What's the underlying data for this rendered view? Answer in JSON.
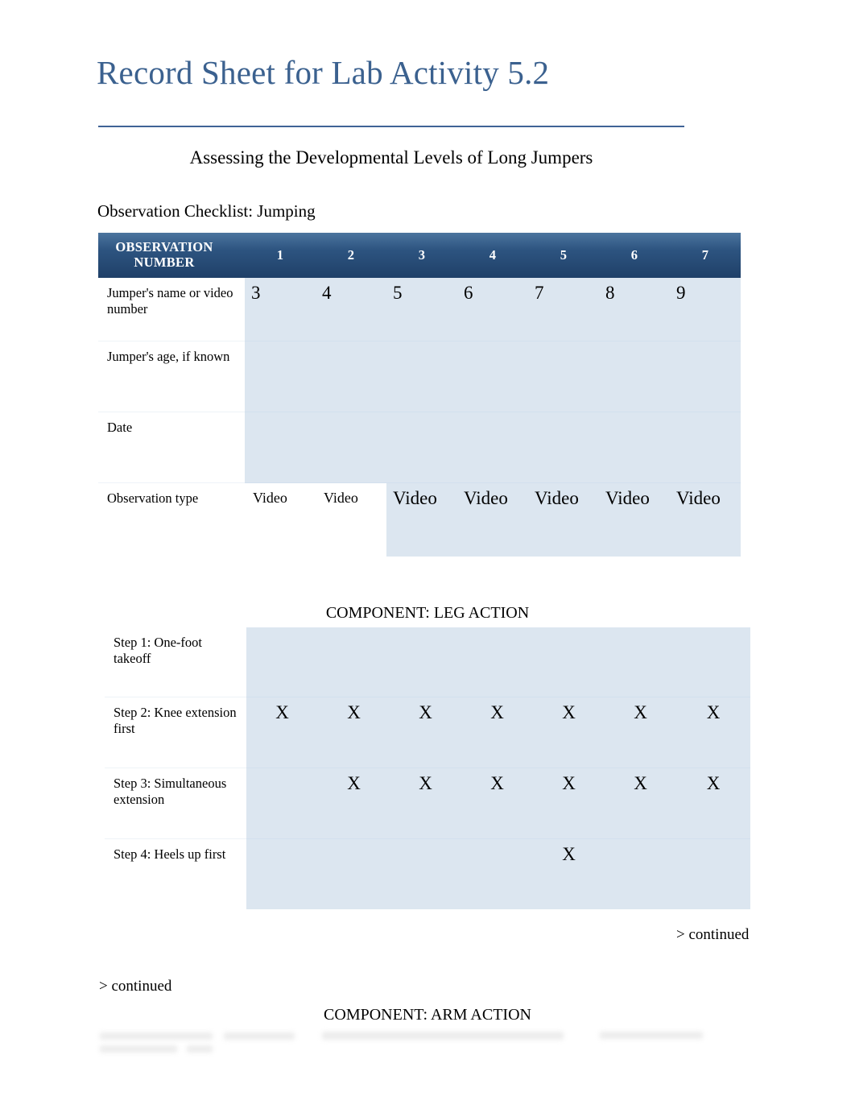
{
  "document": {
    "title": "Record Sheet for Lab Activity 5.2",
    "subtitle": "Assessing the Developmental Levels of Long Jumpers",
    "section_label": "Observation Checklist: Jumping",
    "rule_color": "#3f6396",
    "title_color": "#3b618f",
    "header_band_color": "#1f4068",
    "cell_fill_color": "#dce6f0"
  },
  "observation_table": {
    "header": {
      "row_label": "OBSERVATION NUMBER",
      "row_label_line1": "OBSERVATION",
      "row_label_line2": "NUMBER",
      "columns": [
        "1",
        "2",
        "3",
        "4",
        "5",
        "6",
        "7"
      ]
    },
    "rows": [
      {
        "label": "Jumper's name or video number",
        "values": [
          "3",
          "4",
          "5",
          "6",
          "7",
          "8",
          "9"
        ],
        "style": "large"
      },
      {
        "label": "Jumper's age, if known",
        "values": [
          "",
          "",
          "",
          "",
          "",
          "",
          ""
        ],
        "style": "large"
      },
      {
        "label": "Date",
        "values": [
          "",
          "",
          "",
          "",
          "",
          "",
          ""
        ],
        "style": "large"
      },
      {
        "label": "Observation type",
        "values": [
          "Video",
          "Video",
          "Video",
          "Video",
          "Video",
          "Video",
          "Video"
        ],
        "style": "mixed",
        "small_cells": [
          0,
          1
        ]
      }
    ]
  },
  "leg_action": {
    "title": "COMPONENT: LEG ACTION",
    "rows": [
      {
        "label": "Step 1: One-foot takeoff",
        "marks": [
          "",
          "",
          "",
          "",
          "",
          "",
          ""
        ]
      },
      {
        "label": "Step 2: Knee extension first",
        "marks": [
          "X",
          "X",
          "X",
          "X",
          "X",
          "X",
          "X"
        ]
      },
      {
        "label": "Step 3: Simultaneous extension",
        "marks": [
          "",
          "X",
          "X",
          "X",
          "X",
          "X",
          "X"
        ]
      },
      {
        "label": "Step 4: Heels up first",
        "marks": [
          "",
          "",
          "",
          "",
          "X",
          "",
          ""
        ]
      }
    ]
  },
  "arm_action": {
    "title": "COMPONENT: ARM ACTION"
  },
  "continued_markers": {
    "right": "> continued",
    "left": "> continued"
  }
}
